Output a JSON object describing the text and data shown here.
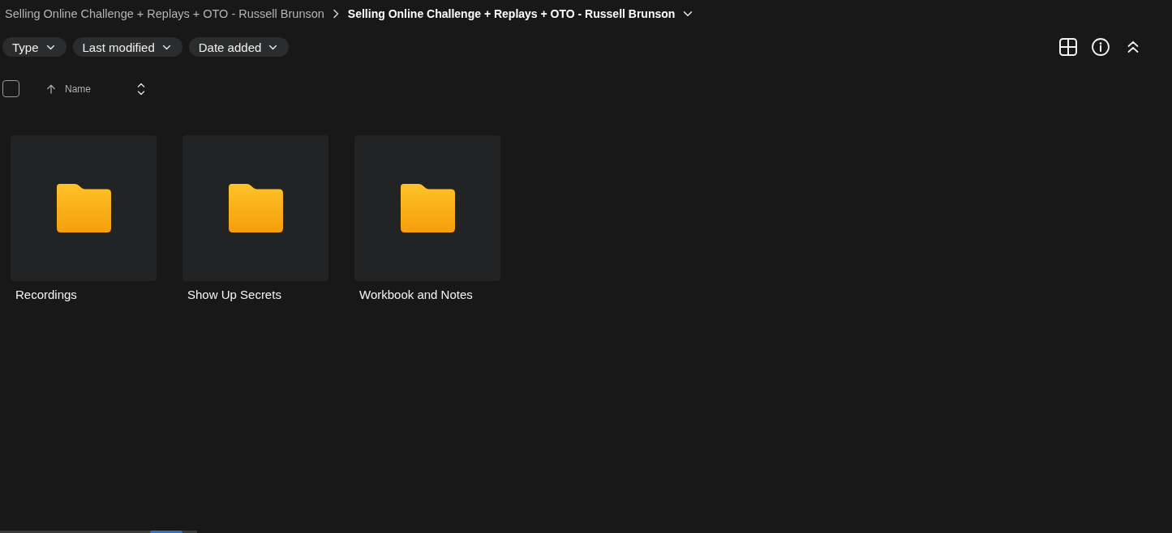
{
  "breadcrumb": [
    {
      "label": "Selling Online Challenge + Replays + OTO - Russell Brunson",
      "current": false
    },
    {
      "label": "Selling Online Challenge + Replays + OTO - Russell Brunson",
      "current": true
    }
  ],
  "filters": [
    {
      "label": "Type"
    },
    {
      "label": "Last modified"
    },
    {
      "label": "Date added"
    }
  ],
  "list_header": {
    "checkbox_checked": false,
    "sort_column": "Name",
    "sort_ascending": true
  },
  "folders": [
    {
      "name": "Recordings"
    },
    {
      "name": "Show Up Secrets"
    },
    {
      "name": "Workbook and Notes"
    }
  ]
}
